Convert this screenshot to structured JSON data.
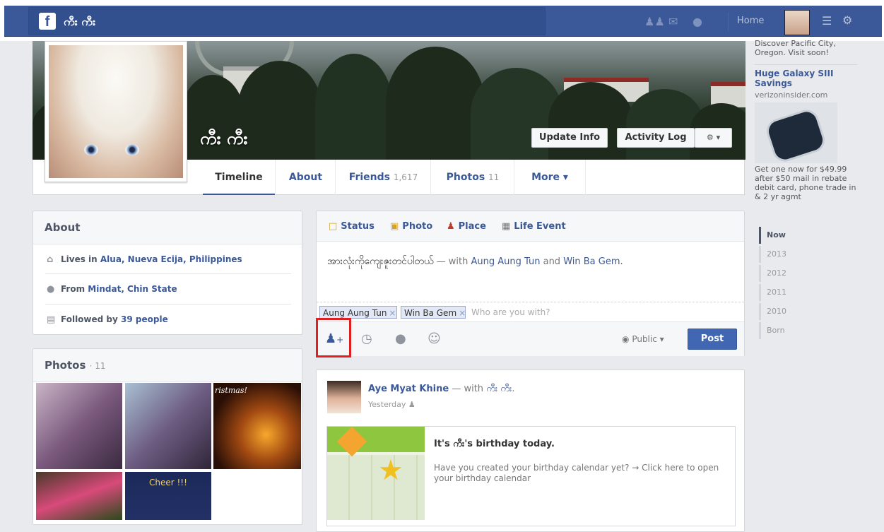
{
  "topbar": {
    "app_title": "ကီး ကီး",
    "home_label": "Home",
    "logo_letter": "f"
  },
  "profile": {
    "name": "ကီး ကီး",
    "update_info": "Update Info",
    "activity_log": "Activity Log",
    "tabs": [
      {
        "label": "Timeline",
        "count": ""
      },
      {
        "label": "About",
        "count": ""
      },
      {
        "label": "Friends",
        "count": "1,617"
      },
      {
        "label": "Photos",
        "count": "11"
      },
      {
        "label": "More ▾",
        "count": ""
      }
    ]
  },
  "about": {
    "heading": "About",
    "lives_prefix": "Lives in",
    "lives_place": "Alua, Nueva Ecija, Philippines",
    "from_prefix": "From",
    "from_place": "Mindat, Chin State",
    "followed_prefix": "Followed by",
    "followed_value": "39 people"
  },
  "photos": {
    "heading": "Photos",
    "count": "· 11",
    "thumb_texts": [
      "ristmas!",
      "Cheer !!!"
    ]
  },
  "composer": {
    "tabs": [
      "Status",
      "Photo",
      "Place",
      "Life Event"
    ],
    "status_text": "အားလုံးကိုကျေးဇူးတင်ပါတယ်",
    "with_text": " — with ",
    "friend1": "Aung Aung Tun",
    "and_text": " and ",
    "friend2": "Win Ba Gem",
    "tags": [
      "Aung Aung Tun",
      "Win Ba Gem"
    ],
    "with_placeholder": "Who are you with?",
    "audience": "Public",
    "post_button": "Post"
  },
  "story": {
    "author": "Aye Myat Khine",
    "with_text": " — with ",
    "with_name": "ကီး ကီး",
    "time": "Yesterday",
    "card_title": "It's ကီး's birthday today.",
    "card_text": "Have you created your birthday calendar yet? → Click here to open your birthday calendar"
  },
  "ads": {
    "ad1_text": "Discover Pacific City, Oregon. Visit soon!",
    "ad2_title": "Huge Galaxy SIII Savings",
    "ad2_domain": "verizoninsider.com",
    "ad2_text": "Get one now for $49.99 after $50 mail in rebate debit card, phone trade in & 2 yr agmt"
  },
  "timeline_years": [
    "Now",
    "2013",
    "2012",
    "2011",
    "2010",
    "Born"
  ],
  "colors": {
    "brand": "#3b5998",
    "highlight_box": "#e02020",
    "post_button": "#4267b2"
  }
}
